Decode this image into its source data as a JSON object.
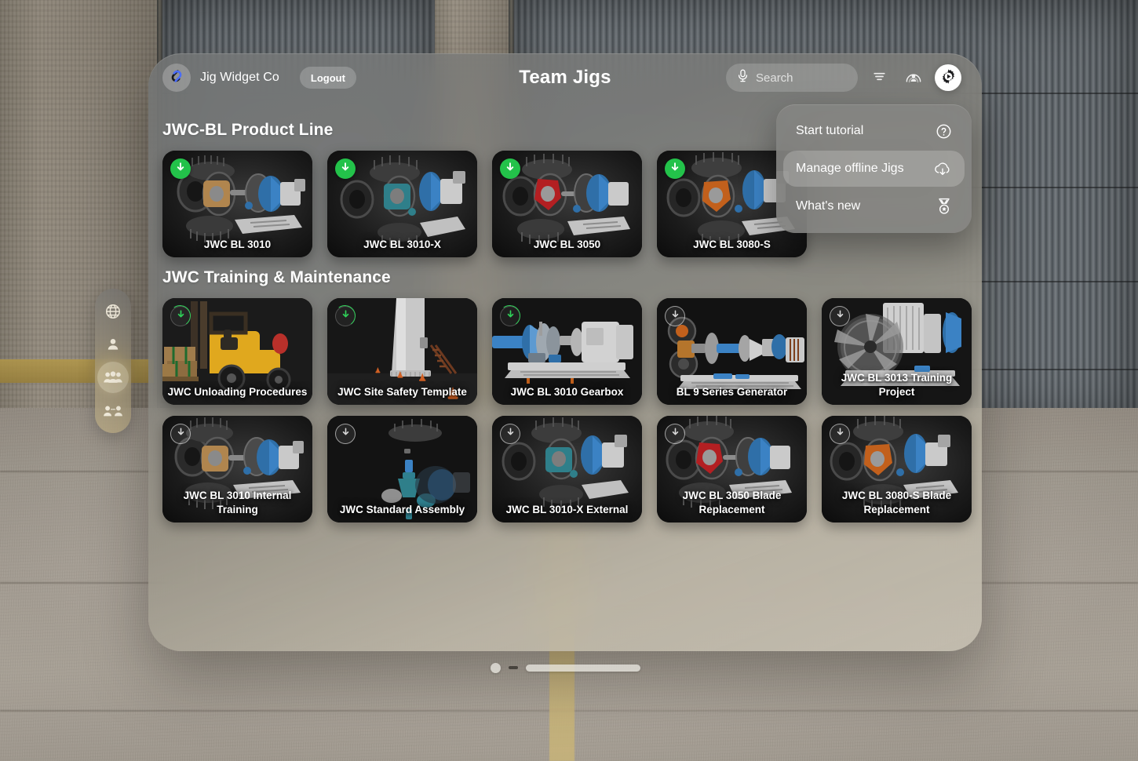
{
  "app": {
    "brand_name": "Jig Widget Co",
    "logout_label": "Logout",
    "title": "Team Jigs",
    "logo_icon": "interlocking-links-logo"
  },
  "search": {
    "placeholder": "Search",
    "value": "",
    "mic_icon": "microphone-icon"
  },
  "header_actions": [
    {
      "name": "sort-filter-button",
      "icon": "filter-lines-icon",
      "active": false
    },
    {
      "name": "share-collaborate-button",
      "icon": "person-arc-icon",
      "active": false
    },
    {
      "name": "settings-button",
      "icon": "gear-play-icon",
      "active": true
    }
  ],
  "settings_menu": {
    "open": true,
    "items": [
      {
        "label": "Start tutorial",
        "icon": "question-circle-icon",
        "highlight": false
      },
      {
        "label": "Manage offline Jigs",
        "icon": "cloud-download-icon",
        "highlight": true
      },
      {
        "label": "What's new",
        "icon": "medal-icon",
        "highlight": false
      }
    ]
  },
  "sidebar": {
    "items": [
      {
        "name": "sidebar-item-explore",
        "icon": "globe-icon",
        "active": false
      },
      {
        "name": "sidebar-item-my-jigs",
        "icon": "person-icon",
        "active": false
      },
      {
        "name": "sidebar-item-team",
        "icon": "people-group-icon",
        "active": true
      },
      {
        "name": "sidebar-item-shared",
        "icon": "people-shared-icon",
        "active": false
      }
    ]
  },
  "sections": [
    {
      "title": "JWC-BL Product Line",
      "rows": [
        [
          {
            "label": "JWC BL 3010",
            "download_state": "done",
            "thumb": "gearbox-exploded-tan"
          },
          {
            "label": "JWC BL 3010-X",
            "download_state": "done",
            "thumb": "gearbox-exploded-teal"
          },
          {
            "label": "JWC BL 3050",
            "download_state": "done",
            "thumb": "gearbox-exploded-red"
          },
          {
            "label": "JWC BL 3080-S",
            "download_state": "done",
            "thumb": "gearbox-exploded-orange"
          }
        ]
      ]
    },
    {
      "title": "JWC Training & Maintenance",
      "rows": [
        [
          {
            "label": "JWC Unloading Procedures",
            "download_state": "done-ring",
            "thumb": "forklift-pallet"
          },
          {
            "label": "JWC Site Safety Template",
            "download_state": "done-ring",
            "thumb": "tower-cones"
          },
          {
            "label": "JWC BL 3010 Gearbox",
            "download_state": "progress",
            "thumb": "gearbox-assembled"
          },
          {
            "label": "BL 9 Series Generator",
            "download_state": "pending",
            "thumb": "generator-shaft"
          },
          {
            "label": "JWC BL 3013 Training Project",
            "download_state": "pending",
            "thumb": "fan-unit"
          }
        ],
        [
          {
            "label": "JWC BL 3010 Internal Training",
            "download_state": "pending",
            "thumb": "gearbox-exploded-tan"
          },
          {
            "label": "JWC Standard Assembly",
            "download_state": "pending",
            "thumb": "sparse-assembly-teal"
          },
          {
            "label": "JWC BL 3010-X External",
            "download_state": "pending",
            "thumb": "gearbox-exploded-teal"
          },
          {
            "label": "JWC BL 3050 Blade Replacement",
            "download_state": "pending",
            "thumb": "gearbox-exploded-red"
          },
          {
            "label": "JWC BL 3080-S Blade Replacement",
            "download_state": "pending",
            "thumb": "gearbox-exploded-orange"
          }
        ]
      ]
    }
  ],
  "colors": {
    "download_done": "#23c24a",
    "accent_logo_blue": "#4a6cf7",
    "panel_glass": "#8b8a84",
    "active_button": "#ffffff"
  }
}
